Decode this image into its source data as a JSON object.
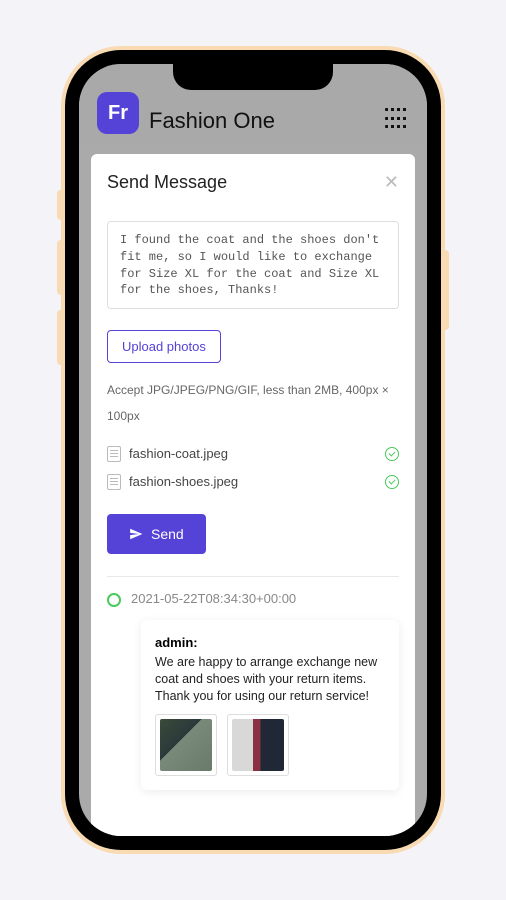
{
  "header": {
    "logo_text": "Fr",
    "app_title": "Fashion One"
  },
  "modal": {
    "title": "Send Message",
    "message_value": "I found the coat and the shoes don't fit me, so I would like to exchange for Size XL for the coat and Size XL for the shoes, Thanks!",
    "upload_label": "Upload photos",
    "accept_text": "Accept JPG/JPEG/PNG/GIF, less than 2MB, 400px × 100px",
    "files": [
      {
        "name": "fashion-coat.jpeg"
      },
      {
        "name": "fashion-shoes.jpeg"
      }
    ],
    "send_label": "Send"
  },
  "timeline": {
    "timestamp": "2021-05-22T08:34:30+00:00",
    "reply": {
      "author": "admin:",
      "body": "We are happy to arrange exchange new coat and shoes with your return items. Thank you for using our return service!"
    }
  }
}
